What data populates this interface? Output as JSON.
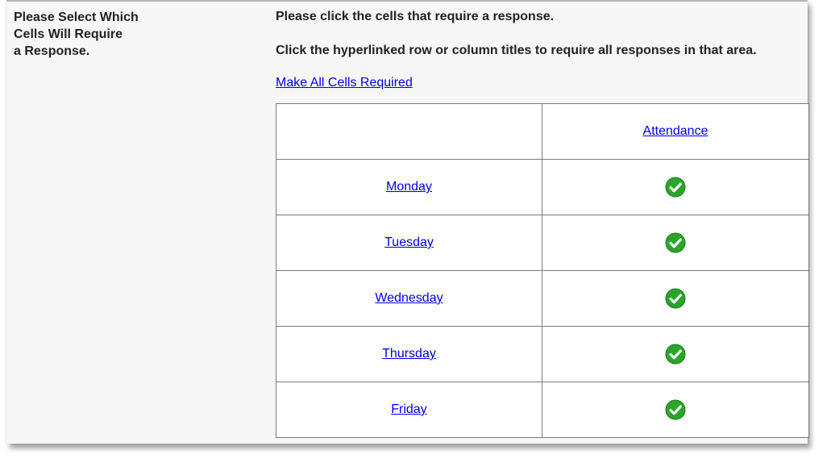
{
  "left_label": "Please Select Which\nCells Will Require\na Response.",
  "instructions": {
    "line1": "Please click the cells that require a response.",
    "line2": "Click the hyperlinked row or column titles to require all responses in that area."
  },
  "make_all_link": "Make All Cells Required",
  "grid": {
    "column_header": "Attendance",
    "rows": [
      {
        "label": "Monday",
        "required": true
      },
      {
        "label": "Tuesday",
        "required": true
      },
      {
        "label": "Wednesday",
        "required": true
      },
      {
        "label": "Thursday",
        "required": true
      },
      {
        "label": "Friday",
        "required": true
      }
    ]
  },
  "colors": {
    "link": "#0000ee",
    "check_green": "#2aa52a"
  },
  "icons": {
    "required_cell": "green-checkmark-icon"
  }
}
